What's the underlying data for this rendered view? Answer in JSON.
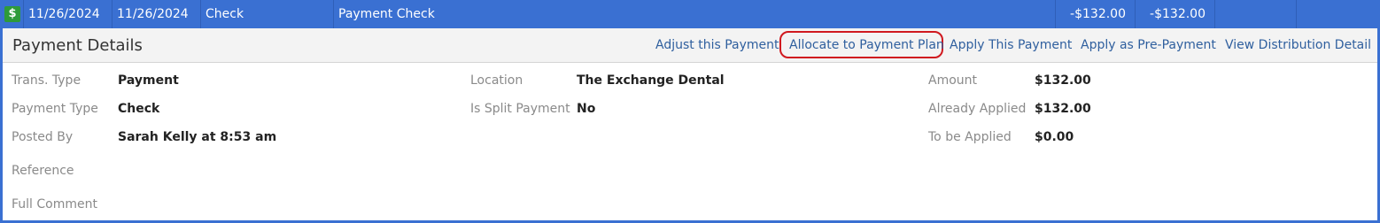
{
  "transaction_row": {
    "icon": "dollar-icon",
    "icon_glyph": "$",
    "date_1": "11/26/2024",
    "date_2": "11/26/2024",
    "type": "Check",
    "description": "Payment Check",
    "amount_1": "-$132.00",
    "amount_2": "-$132.00",
    "colors": {
      "row_background": "#3a70d2",
      "badge_background": "#2e9a3a"
    }
  },
  "payment_details": {
    "title": "Payment Details",
    "actions": [
      {
        "label": "Adjust this Payment"
      },
      {
        "label": "Allocate to Payment Plan",
        "highlighted": true
      },
      {
        "label": "Apply This Payment"
      },
      {
        "label": "Apply as Pre-Payment"
      },
      {
        "label": "View Distribution Detail"
      }
    ],
    "highlight_color": "#d0191f"
  },
  "fields": {
    "left": [
      {
        "label": "Trans. Type",
        "value": "Payment"
      },
      {
        "label": "Payment Type",
        "value": "Check"
      },
      {
        "label": "Posted By",
        "value": "Sarah Kelly at 8:53 am"
      },
      {
        "label": "Reference",
        "value": ""
      },
      {
        "label": "Full Comment",
        "value": ""
      }
    ],
    "middle": [
      {
        "label": "Location",
        "value": "The Exchange Dental"
      },
      {
        "label": "Is Split Payment",
        "value": "No"
      }
    ],
    "right": [
      {
        "label": "Amount",
        "value": "$132.00"
      },
      {
        "label": "Already Applied",
        "value": "$132.00"
      },
      {
        "label": "To be Applied",
        "value": "$0.00"
      }
    ]
  }
}
